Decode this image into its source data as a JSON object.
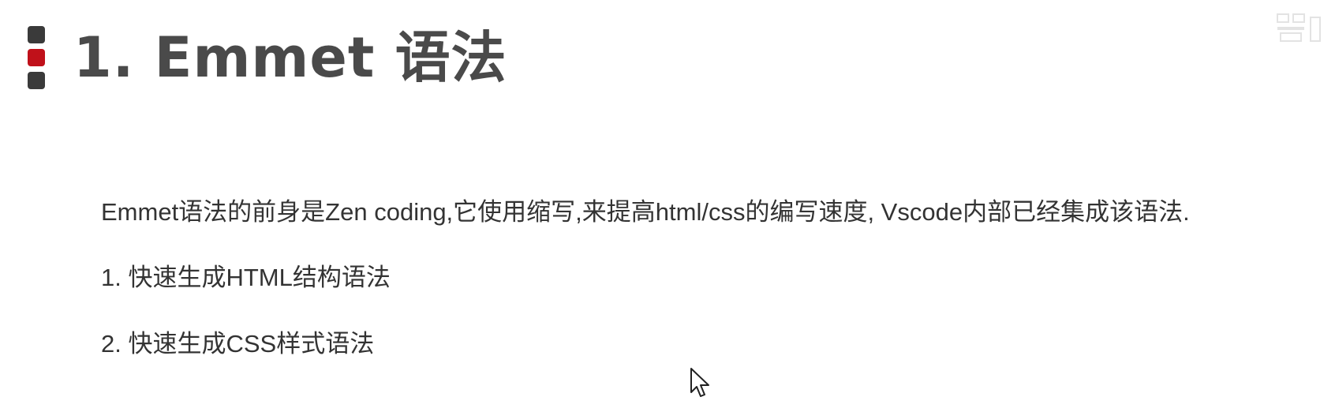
{
  "slide": {
    "title": "1. Emmet 语法",
    "description": "Emmet语法的前身是Zen coding,它使用缩写,来提高html/css的编写速度, Vscode内部已经集成该语法.",
    "items": [
      {
        "label": "1. 快速生成HTML结构语法"
      },
      {
        "label": "2. 快速生成CSS样式语法"
      }
    ]
  },
  "colors": {
    "title": "#4a4a4a",
    "text": "#333333",
    "marker_dark": "#3a3a3a",
    "marker_accent": "#c0111a",
    "background": "#ffffff"
  },
  "icons": {
    "cursor": "mouse-pointer-icon",
    "watermark": "watermark-logo-icon"
  }
}
